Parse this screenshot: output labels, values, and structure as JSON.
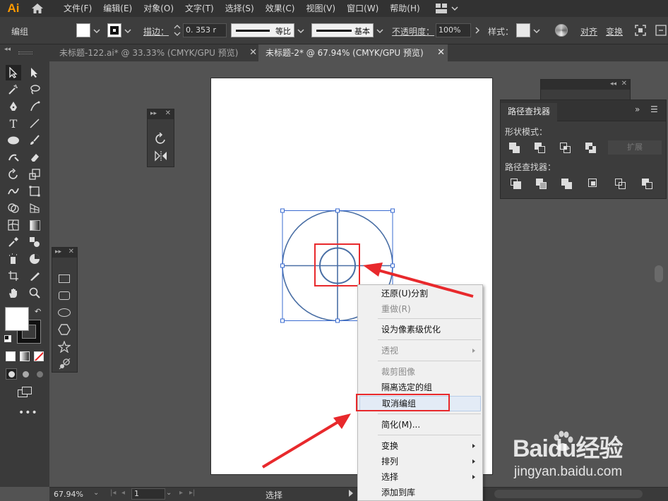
{
  "menubar": {
    "logo": "Ai",
    "items": [
      "文件(F)",
      "编辑(E)",
      "对象(O)",
      "文字(T)",
      "选择(S)",
      "效果(C)",
      "视图(V)",
      "窗口(W)",
      "帮助(H)"
    ]
  },
  "controlbar": {
    "selection_label": "编组",
    "stroke_label": "描边：",
    "stroke_value": "0. 353 r",
    "profile1": "等比",
    "profile2": "基本",
    "opacity_label": "不透明度：",
    "opacity_value": "100%",
    "style_label": "样式：",
    "align_label": "对齐",
    "transform_label": "变换"
  },
  "tabs": [
    {
      "label": "未标题-122.ai* @ 33.33% (CMYK/GPU 预览)",
      "active": false
    },
    {
      "label": "未标题-2* @ 67.94% (CMYK/GPU 预览)",
      "active": true
    }
  ],
  "pathfinder": {
    "title": "路径查找器",
    "shape_modes_label": "形状模式：",
    "expand_label": "扩展",
    "pathfinders_label": "路径查找器："
  },
  "context_menu": {
    "items": [
      {
        "label": "还原(U)分割",
        "enabled": true
      },
      {
        "label": "重做(R)",
        "enabled": false
      },
      {
        "label": "设为像素级优化",
        "enabled": true
      },
      {
        "label": "透视",
        "enabled": false,
        "submenu": true
      },
      {
        "label": "裁剪图像",
        "enabled": false
      },
      {
        "label": "隔离选定的组",
        "enabled": true
      },
      {
        "label": "取消编组",
        "enabled": true,
        "highlighted": true
      },
      {
        "label": "简化(M)...",
        "enabled": true
      },
      {
        "label": "变换",
        "enabled": true,
        "submenu": true
      },
      {
        "label": "排列",
        "enabled": true,
        "submenu": true
      },
      {
        "label": "选择",
        "enabled": true,
        "submenu": true
      },
      {
        "label": "添加到库",
        "enabled": true
      }
    ]
  },
  "statusbar": {
    "zoom": "67.94%",
    "page": "1",
    "tool_name": "选择"
  },
  "watermark": {
    "brand": "Baidu经验",
    "url": "jingyan.baidu.com"
  },
  "colors": {
    "accent_red": "#e8292c",
    "artwork_stroke": "#4a6fa5",
    "selection_blue": "#3a6bd1"
  }
}
